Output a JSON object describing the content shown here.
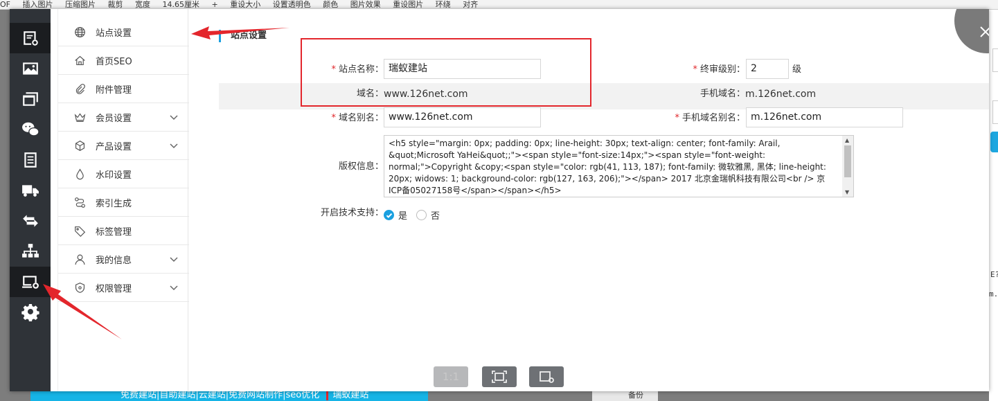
{
  "background": {
    "toolbar_items": [
      "OF",
      "插入图片",
      "压缩图片",
      "裁剪",
      "宽度",
      "14.65厘米",
      "+",
      "重设大小",
      "设置透明色",
      "颜色",
      "图片效果",
      "重设图片",
      "环绕",
      "对齐"
    ],
    "bottom_text": "免费建站|自助建站|云建站|免费网站制作|seo优化",
    "bottom_brand": "瑞蚁建站",
    "bottom_right_label": "备份",
    "snippet_1": "E?",
    "snippet_2": "m.1"
  },
  "rail": {
    "items": [
      "site-settings-icon",
      "image-icon",
      "window-icon",
      "wechat-icon",
      "document-icon",
      "truck-icon",
      "exchange-icon",
      "sitemap-icon",
      "monitor-settings-icon",
      "gear-icon"
    ],
    "active_index": 8
  },
  "menu": {
    "items": [
      {
        "label": "站点设置",
        "icon": "globe-icon",
        "expandable": false
      },
      {
        "label": "首页SEO",
        "icon": "home-icon",
        "expandable": false
      },
      {
        "label": "附件管理",
        "icon": "paperclip-icon",
        "expandable": false
      },
      {
        "label": "会员设置",
        "icon": "crown-icon",
        "expandable": true
      },
      {
        "label": "产品设置",
        "icon": "box-icon",
        "expandable": true
      },
      {
        "label": "水印设置",
        "icon": "drop-icon",
        "expandable": false
      },
      {
        "label": "索引生成",
        "icon": "route-icon",
        "expandable": false
      },
      {
        "label": "标签管理",
        "icon": "tag-icon",
        "expandable": false
      },
      {
        "label": "我的信息",
        "icon": "user-icon",
        "expandable": true
      },
      {
        "label": "权限管理",
        "icon": "shield-icon",
        "expandable": true
      }
    ]
  },
  "form": {
    "section_title": "站点设置",
    "required_mark": "*",
    "site_name_label": "站点名称：",
    "site_name_value": "瑞蚁建站",
    "final_review_label": "终审级别：",
    "final_review_value": "2",
    "final_review_unit": "级",
    "domain_label": "域名：",
    "domain_value": "www.126net.com",
    "mobile_domain_label": "手机域名：",
    "mobile_domain_value": "m.126net.com",
    "domain_alias_label": "域名别名：",
    "domain_alias_value": "www.126net.com",
    "mobile_alias_label": "手机域名别名：",
    "mobile_alias_value": "m.126net.com",
    "copyright_label": "版权信息：",
    "copyright_value": "<h5 style=\"margin: 0px; padding: 0px; line-height: 30px; text-align: center; font-family: Arail, &quot;Microsoft YaHei&quot;;\"><span style=\"font-size:14px;\"><span style=\"font-weight: normal;\">Copyright &copy;<span style=\"color: rgb(41, 113, 187); font-family: 微软雅黑, 黑体; line-height: 20px; widows: 1; background-color: rgb(127, 163, 206);\"></span> 2017 北京金瑞帆科技有限公司<br /> 京ICP备05027158号</span></span></h5>",
    "tech_support_label": "开启技术支持：",
    "tech_support_yes": "是",
    "tech_support_no": "否",
    "tech_support_selected": "是"
  },
  "image_toolbar": {
    "actual_size_label": "1:1"
  },
  "colors": {
    "rail_bg": "#2f3338",
    "accent": "#1aa0e0",
    "required": "#e0262a",
    "annotation_red": "#e3262c"
  }
}
